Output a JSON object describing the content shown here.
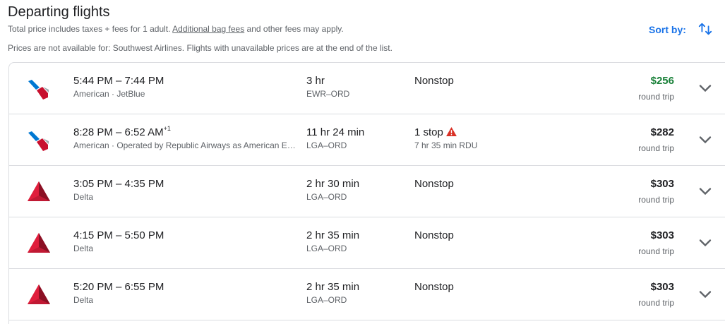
{
  "header": {
    "title": "Departing flights",
    "subtitle_before": "Total price includes taxes + fees for 1 adult. ",
    "bag_fees_link": "Additional bag fees",
    "subtitle_after": " and other fees may apply.",
    "unavailable_note": "Prices are not available for: Southwest Airlines. Flights with unavailable prices are at the end of the list.",
    "sort_label": "Sort by:"
  },
  "colors": {
    "accent": "#1a73e8",
    "cheapest_price": "#188038",
    "warning": "#d93025",
    "american_red": "#c8102e",
    "american_blue": "#0078d2",
    "delta_red": "#c01933"
  },
  "flights": [
    {
      "times": "5:44 PM – 7:44 PM",
      "day_offset": "",
      "airline": "American · JetBlue",
      "logo": "american-airlines-logo",
      "duration": "3 hr",
      "route": "EWR–ORD",
      "stops": "Nonstop",
      "layover": "",
      "price": "$256",
      "price_note": "round trip"
    },
    {
      "times": "8:28 PM – 6:52 AM",
      "day_offset": "+1",
      "airline": "American · Operated by Republic Airways as American Eagle",
      "logo": "american-airlines-logo",
      "duration": "11 hr 24 min",
      "route": "LGA–ORD",
      "stops": "1 stop",
      "layover": "7 hr 35 min RDU",
      "price": "$282",
      "price_note": "round trip"
    },
    {
      "times": "3:05 PM – 4:35 PM",
      "day_offset": "",
      "airline": "Delta",
      "logo": "delta-logo",
      "duration": "2 hr 30 min",
      "route": "LGA–ORD",
      "stops": "Nonstop",
      "layover": "",
      "price": "$303",
      "price_note": "round trip"
    },
    {
      "times": "4:15 PM – 5:50 PM",
      "day_offset": "",
      "airline": "Delta",
      "logo": "delta-logo",
      "duration": "2 hr 35 min",
      "route": "LGA–ORD",
      "stops": "Nonstop",
      "layover": "",
      "price": "$303",
      "price_note": "round trip"
    },
    {
      "times": "5:20 PM – 6:55 PM",
      "day_offset": "",
      "airline": "Delta",
      "logo": "delta-logo",
      "duration": "2 hr 35 min",
      "route": "LGA–ORD",
      "stops": "Nonstop",
      "layover": "",
      "price": "$303",
      "price_note": "round trip"
    }
  ]
}
